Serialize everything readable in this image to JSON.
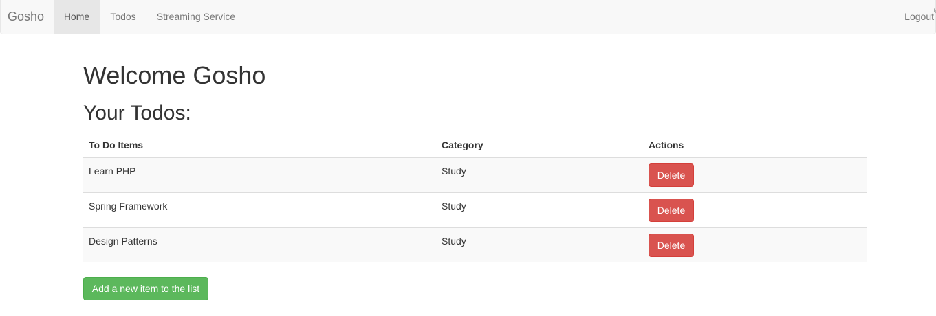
{
  "navbar": {
    "brand": "Gosho",
    "items": [
      {
        "label": "Home",
        "active": true
      },
      {
        "label": "Todos",
        "active": false
      },
      {
        "label": "Streaming Service",
        "active": false
      }
    ],
    "logout_label": "Logout",
    "logout_mark": "↳"
  },
  "main": {
    "welcome": "Welcome Gosho",
    "subtitle": "Your Todos:",
    "table": {
      "headers": [
        "To Do Items",
        "Category",
        "Actions"
      ],
      "rows": [
        {
          "item": "Learn PHP",
          "category": "Study",
          "action": "Delete"
        },
        {
          "item": "Spring Framework",
          "category": "Study",
          "action": "Delete"
        },
        {
          "item": "Design Patterns",
          "category": "Study",
          "action": "Delete"
        }
      ]
    },
    "add_button": "Add a new item to the list"
  },
  "colors": {
    "navbar_bg": "#f8f8f8",
    "active_tab_bg": "#e7e7e7",
    "danger": "#d9534f",
    "success": "#5cb85c"
  }
}
